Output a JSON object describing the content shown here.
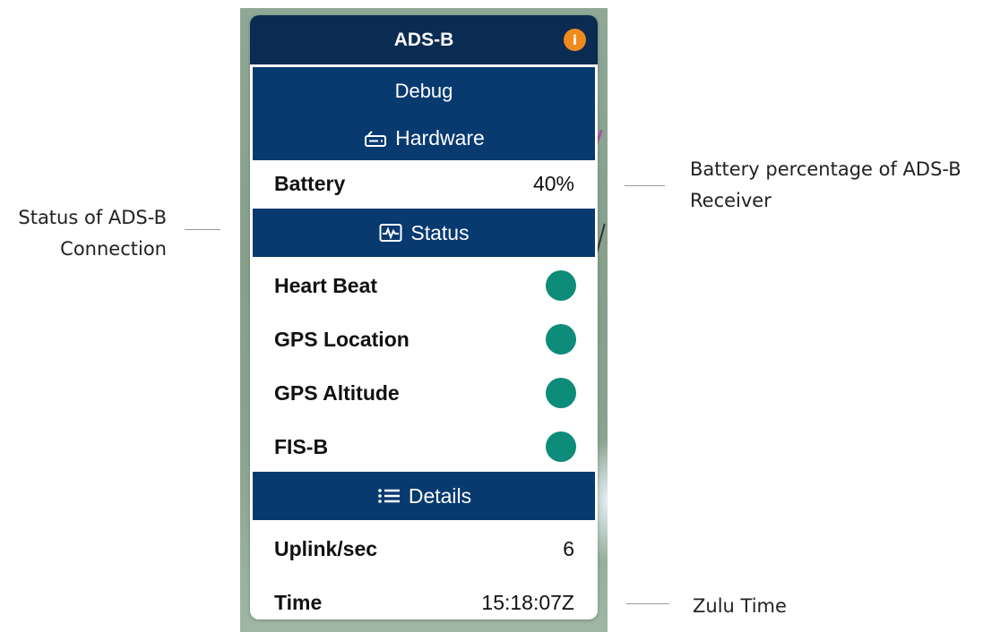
{
  "panel": {
    "title": "ADS-B",
    "info_icon": "info-icon",
    "debug_label": "Debug",
    "hardware": {
      "label": "Hardware",
      "icon": "router-icon"
    },
    "battery": {
      "label": "Battery",
      "value": "40%"
    },
    "status": {
      "label": "Status",
      "icon": "activity-monitor-icon",
      "items": [
        {
          "label": "Heart Beat",
          "state": "ok"
        },
        {
          "label": "GPS Location",
          "state": "ok"
        },
        {
          "label": "GPS Altitude",
          "state": "ok"
        },
        {
          "label": "FIS-B",
          "state": "ok"
        }
      ]
    },
    "details": {
      "label": "Details",
      "icon": "list-icon",
      "uplink": {
        "label": "Uplink/sec",
        "value": "6"
      },
      "time": {
        "label": "Time",
        "value": "15:18:07Z"
      }
    }
  },
  "callouts": {
    "status": {
      "line1": "Status of ADS-B",
      "line2": "Connection"
    },
    "battery": {
      "line1": "Battery percentage of ADS-B",
      "line2": "Receiver"
    },
    "time": {
      "line1": "Zulu Time"
    }
  },
  "colors": {
    "header": "#0a2b52",
    "section": "#083a70",
    "status_ok": "#0e8c7a",
    "info": "#f08a1c"
  }
}
